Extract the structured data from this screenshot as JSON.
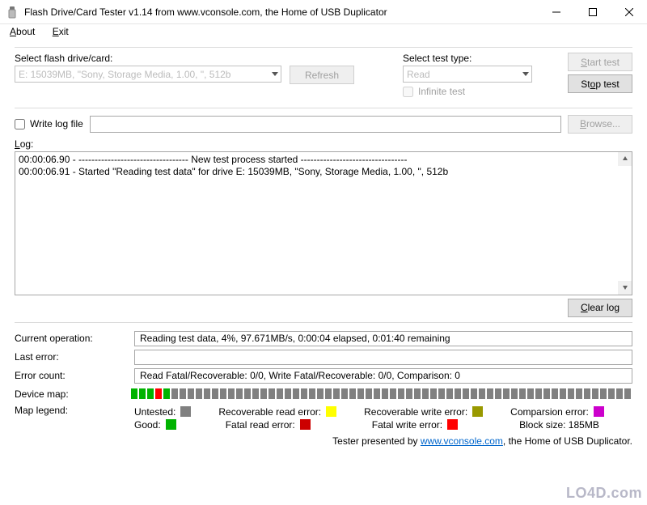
{
  "window": {
    "title": "Flash Drive/Card Tester v1.14 from www.vconsole.com, the Home of USB Duplicator"
  },
  "menu": {
    "about": "About",
    "exit": "Exit"
  },
  "flash": {
    "label": "Select flash drive/card:",
    "value": "E: 15039MB, \"Sony, Storage Media, 1.00, \", 512b",
    "refresh": "Refresh"
  },
  "test": {
    "label": "Select test type:",
    "value": "Read",
    "infinite": "Infinite test",
    "start": "Start test",
    "stop": "Stop test"
  },
  "logfile": {
    "writelog": "Write log file",
    "browse": "Browse..."
  },
  "log": {
    "label": "Log:",
    "lines": [
      "00:00:06.90 - ---------------------------------- New test process started ---------------------------------",
      "00:00:06.91 - Started \"Reading test data\" for drive E: 15039MB, \"Sony, Storage Media, 1.00, \", 512b"
    ],
    "clear": "Clear log"
  },
  "status": {
    "current_label": "Current operation:",
    "current_value": "Reading test data, 4%, 97.671MB/s, 0:00:04 elapsed, 0:01:40 remaining",
    "lasterr_label": "Last error:",
    "lasterr_value": "",
    "errcount_label": "Error count:",
    "errcount_value": "Read Fatal/Recoverable: 0/0, Write Fatal/Recoverable: 0/0, Comparison: 0",
    "devmap_label": "Device map:",
    "legend_label": "Map legend:"
  },
  "legend": {
    "untested": "Untested:",
    "good": "Good:",
    "rec_read": "Recoverable read error:",
    "fatal_read": "Fatal read error:",
    "rec_write": "Recoverable write error:",
    "fatal_write": "Fatal write error:",
    "comparison": "Comparsion error:",
    "block_size": "Block size: 185MB"
  },
  "footer": {
    "prefix": "Tester presented by ",
    "link": "www.vconsole.com",
    "suffix": ", the Home of USB Duplicator."
  },
  "watermark": "LO4D.com"
}
